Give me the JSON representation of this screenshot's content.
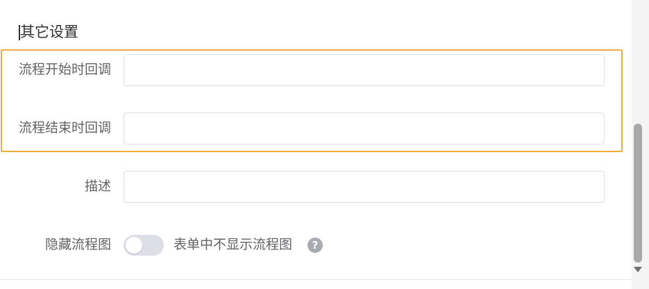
{
  "section": {
    "title": "其它设置"
  },
  "fields": {
    "start_callback": {
      "label": "流程开始时回调",
      "value": "",
      "placeholder": ""
    },
    "end_callback": {
      "label": "流程结束时回调",
      "value": "",
      "placeholder": ""
    },
    "description": {
      "label": "描述",
      "value": "",
      "placeholder": ""
    },
    "hide_flowchart": {
      "label": "隐藏流程图",
      "toggle_state": "off",
      "toggle_description": "表单中不显示流程图",
      "help_icon": "?"
    }
  },
  "colors": {
    "highlight": "#f0ad3c",
    "label": "#606266",
    "input_border": "#dcdfe6",
    "toggle_off": "#dcdfe6",
    "help_icon_bg": "#a8abb2"
  },
  "icons": {
    "help": "question-circle-icon",
    "scroll_down": "triangle-down-icon"
  }
}
